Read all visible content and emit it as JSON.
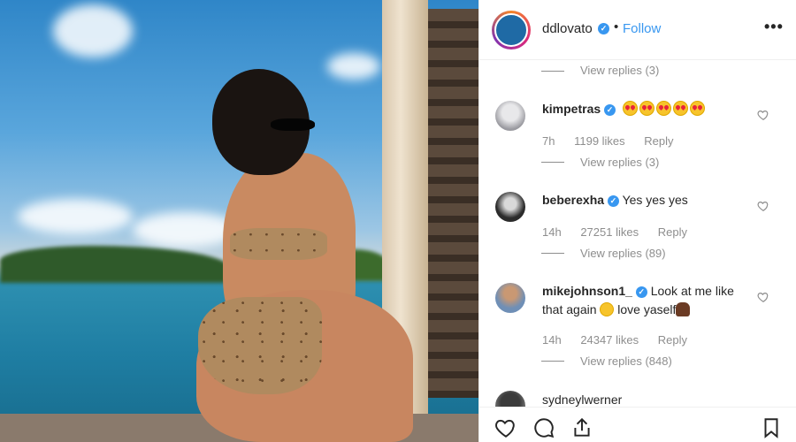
{
  "post": {
    "username": "ddlovato",
    "follow_label": "Follow",
    "separator": "•",
    "more_label": "•••"
  },
  "comments": {
    "top_view_replies": "View replies (3)",
    "items": [
      {
        "username": "kimpetras",
        "text": "",
        "emoji_count": 5,
        "time": "7h",
        "likes": "1199 likes",
        "reply_label": "Reply",
        "view_replies": "View replies (3)"
      },
      {
        "username": "beberexha",
        "text": "Yes yes yes",
        "time": "14h",
        "likes": "27251 likes",
        "reply_label": "Reply",
        "view_replies": "View replies (89)"
      },
      {
        "username": "mikejohnson1_",
        "text_part1": "Look at me like that again",
        "text_part2": "love yaself",
        "time": "14h",
        "likes": "24347 likes",
        "reply_label": "Reply",
        "view_replies": "View replies (848)"
      },
      {
        "username": "sydneylwerner"
      }
    ]
  },
  "icons": {
    "verified": "verified-badge-icon",
    "heart": "heart-outline-icon",
    "comment": "comment-bubble-icon",
    "share": "share-icon",
    "bookmark": "bookmark-icon"
  },
  "colors": {
    "link_blue": "#3897f0",
    "muted_text": "#8e8e8e"
  }
}
